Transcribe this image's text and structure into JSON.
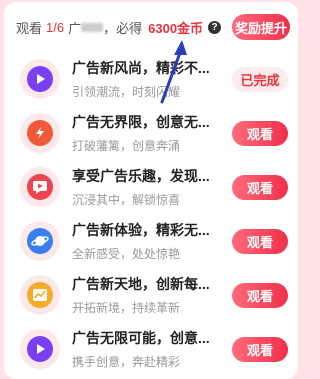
{
  "header": {
    "watch_label": "观看",
    "progress": "1/6",
    "mid_text_a": "广",
    "mid_text_b": "，必得",
    "coins": "6300金币",
    "boost_label": "奖励提升",
    "help_glyph": "?"
  },
  "tasks": [
    {
      "title": "广告新风尚，精彩不...",
      "subtitle": "引领潮流，时刻闪耀",
      "button": "已完成",
      "status": "done",
      "icon": "play-icon",
      "color": "#7b3ff2"
    },
    {
      "title": "广告无界限，创意无...",
      "subtitle": "打破藩篱，创意奔涌",
      "button": "观看",
      "status": "watch",
      "icon": "lightning-icon",
      "color": "#f05a3a"
    },
    {
      "title": "享受广告乐趣，发现...",
      "subtitle": "沉浸其中，解锁惊喜",
      "button": "观看",
      "status": "watch",
      "icon": "chat-play-icon",
      "color": "#ee4450"
    },
    {
      "title": "广告新体验，精彩无...",
      "subtitle": "全新感受，处处惊艳",
      "button": "观看",
      "status": "watch",
      "icon": "planet-icon",
      "color": "#3a7ef0"
    },
    {
      "title": "广告新天地，创新每...",
      "subtitle": "开拓新境，持续革新",
      "button": "观看",
      "status": "watch",
      "icon": "chart-icon",
      "color": "#f7a928"
    },
    {
      "title": "广告无限可能，创意...",
      "subtitle": "携手创意，奔赴精彩",
      "button": "观看",
      "status": "watch",
      "icon": "play-icon",
      "color": "#7b3ff2"
    }
  ]
}
